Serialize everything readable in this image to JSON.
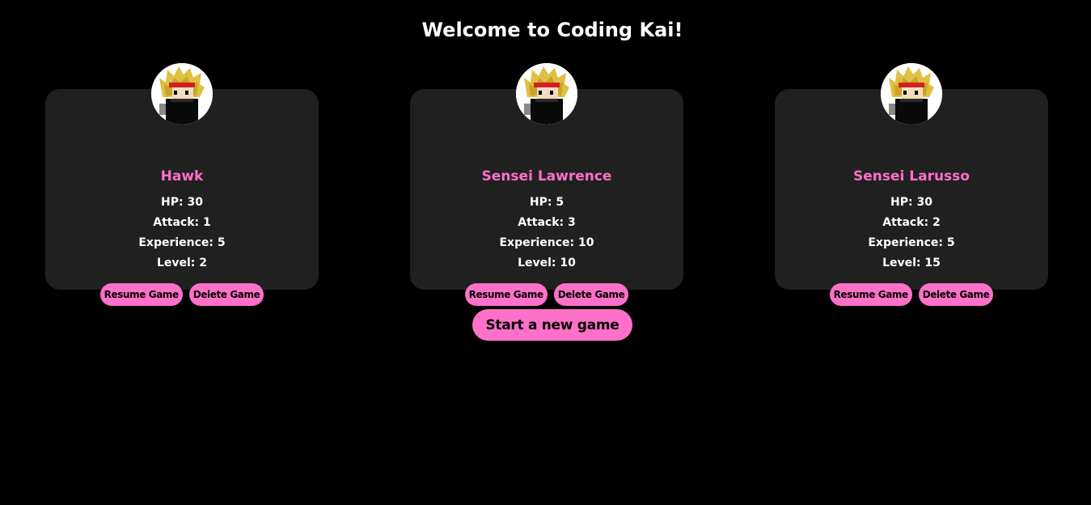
{
  "title": "Welcome to Coding Kai!",
  "colors": {
    "background": "#000000",
    "card": "#202020",
    "accent": "#ff70c8",
    "text": "#ffffff"
  },
  "labels": {
    "hp": "HP: ",
    "attack": "Attack: ",
    "experience": "Experience: ",
    "level": "Level: "
  },
  "characters": [
    {
      "name": "Hawk",
      "avatar_icon": "pixel-ninja-avatar-icon",
      "hp": "HP: 30",
      "attack": "Attack: 1",
      "experience": "Experience: 5",
      "level": "Level: 2",
      "resume_label": "Resume Game",
      "delete_label": "Delete Game"
    },
    {
      "name": "Sensei Lawrence",
      "avatar_icon": "pixel-ninja-avatar-icon",
      "hp": "HP: 5",
      "attack": "Attack: 3",
      "experience": "Experience: 10",
      "level": "Level: 10",
      "resume_label": "Resume Game",
      "delete_label": "Delete Game"
    },
    {
      "name": "Sensei Larusso",
      "avatar_icon": "pixel-ninja-avatar-icon",
      "hp": "HP: 30",
      "attack": "Attack: 2",
      "experience": "Experience: 5",
      "level": "Level: 15",
      "resume_label": "Resume Game",
      "delete_label": "Delete Game"
    }
  ],
  "start_button_label": "Start a new game"
}
